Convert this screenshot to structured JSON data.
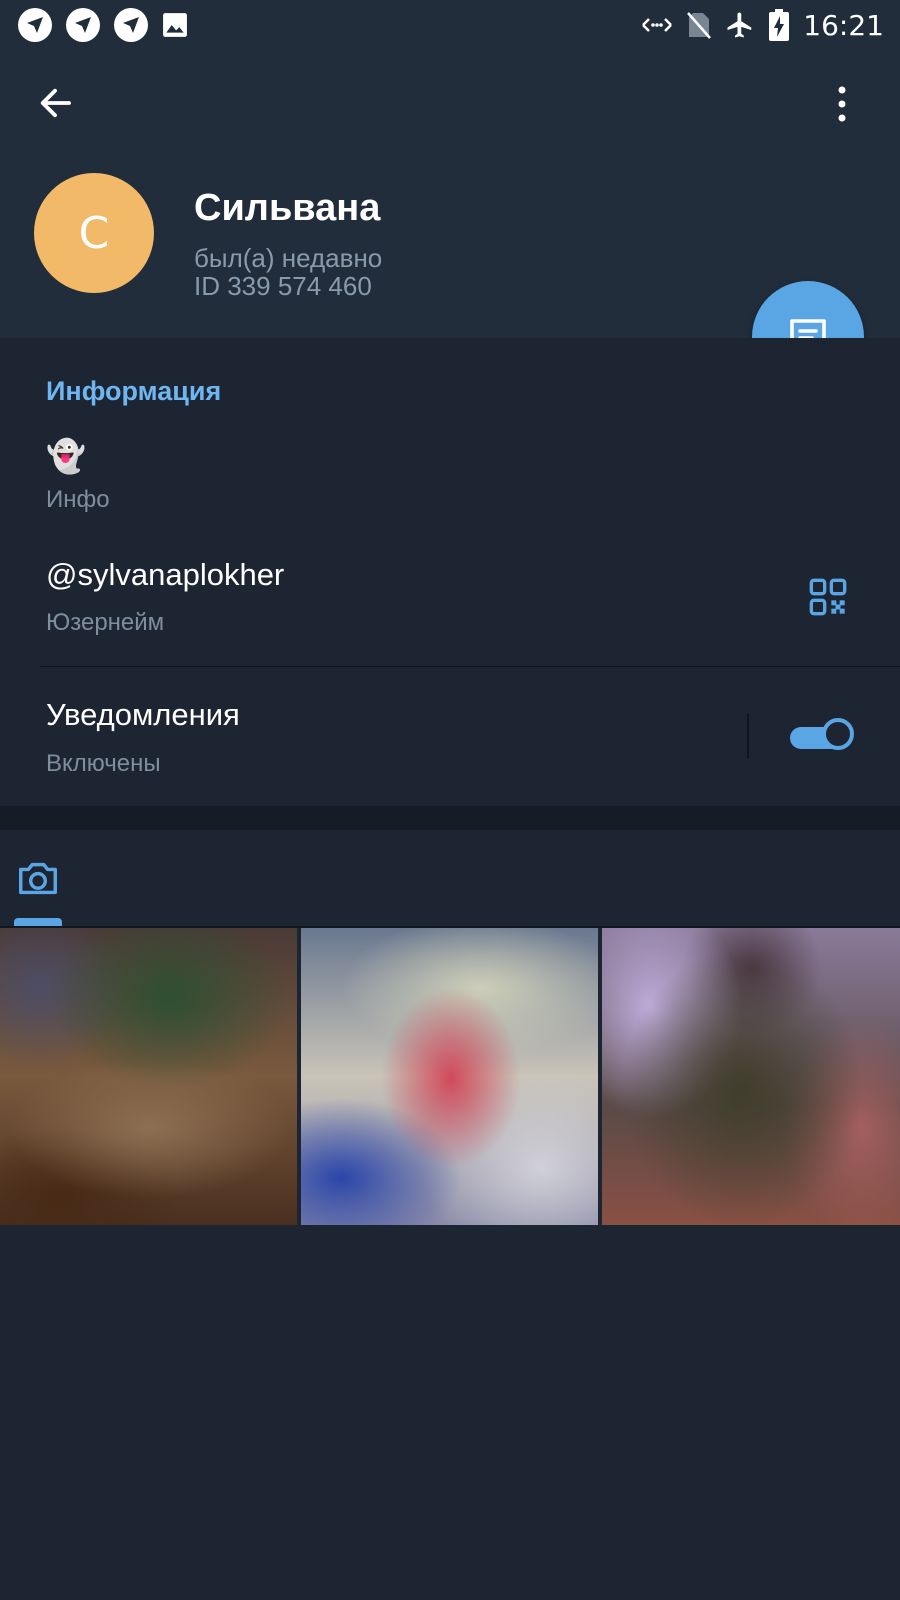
{
  "status_bar": {
    "time": "16:21",
    "left_icons": [
      "app-notification-icon",
      "app-notification-icon",
      "app-notification-icon",
      "image-icon"
    ],
    "right_icons": [
      "data-sync-icon",
      "no-sim-icon",
      "airplane-icon",
      "battery-charging-icon"
    ]
  },
  "profile": {
    "avatar_letter": "С",
    "avatar_color": "#f1b968",
    "name": "Сильвана",
    "status": "был(а) недавно",
    "id_text": "ID 339 574 460"
  },
  "info": {
    "section_title": "Информация",
    "bio_emoji": "👻",
    "bio_label": "Инфо",
    "username": "@sylvanaplokher",
    "username_label": "Юзернейм",
    "notifications_title": "Уведомления",
    "notifications_state": "Включены",
    "notifications_enabled": true
  },
  "media": {
    "active_tab": "photos",
    "tiles": [
      "photo-1",
      "photo-2",
      "photo-3"
    ]
  },
  "colors": {
    "accent": "#5aa5e3",
    "section_title": "#6fb6f0",
    "header_bg": "#212d3b",
    "body_bg": "#1d2533"
  }
}
